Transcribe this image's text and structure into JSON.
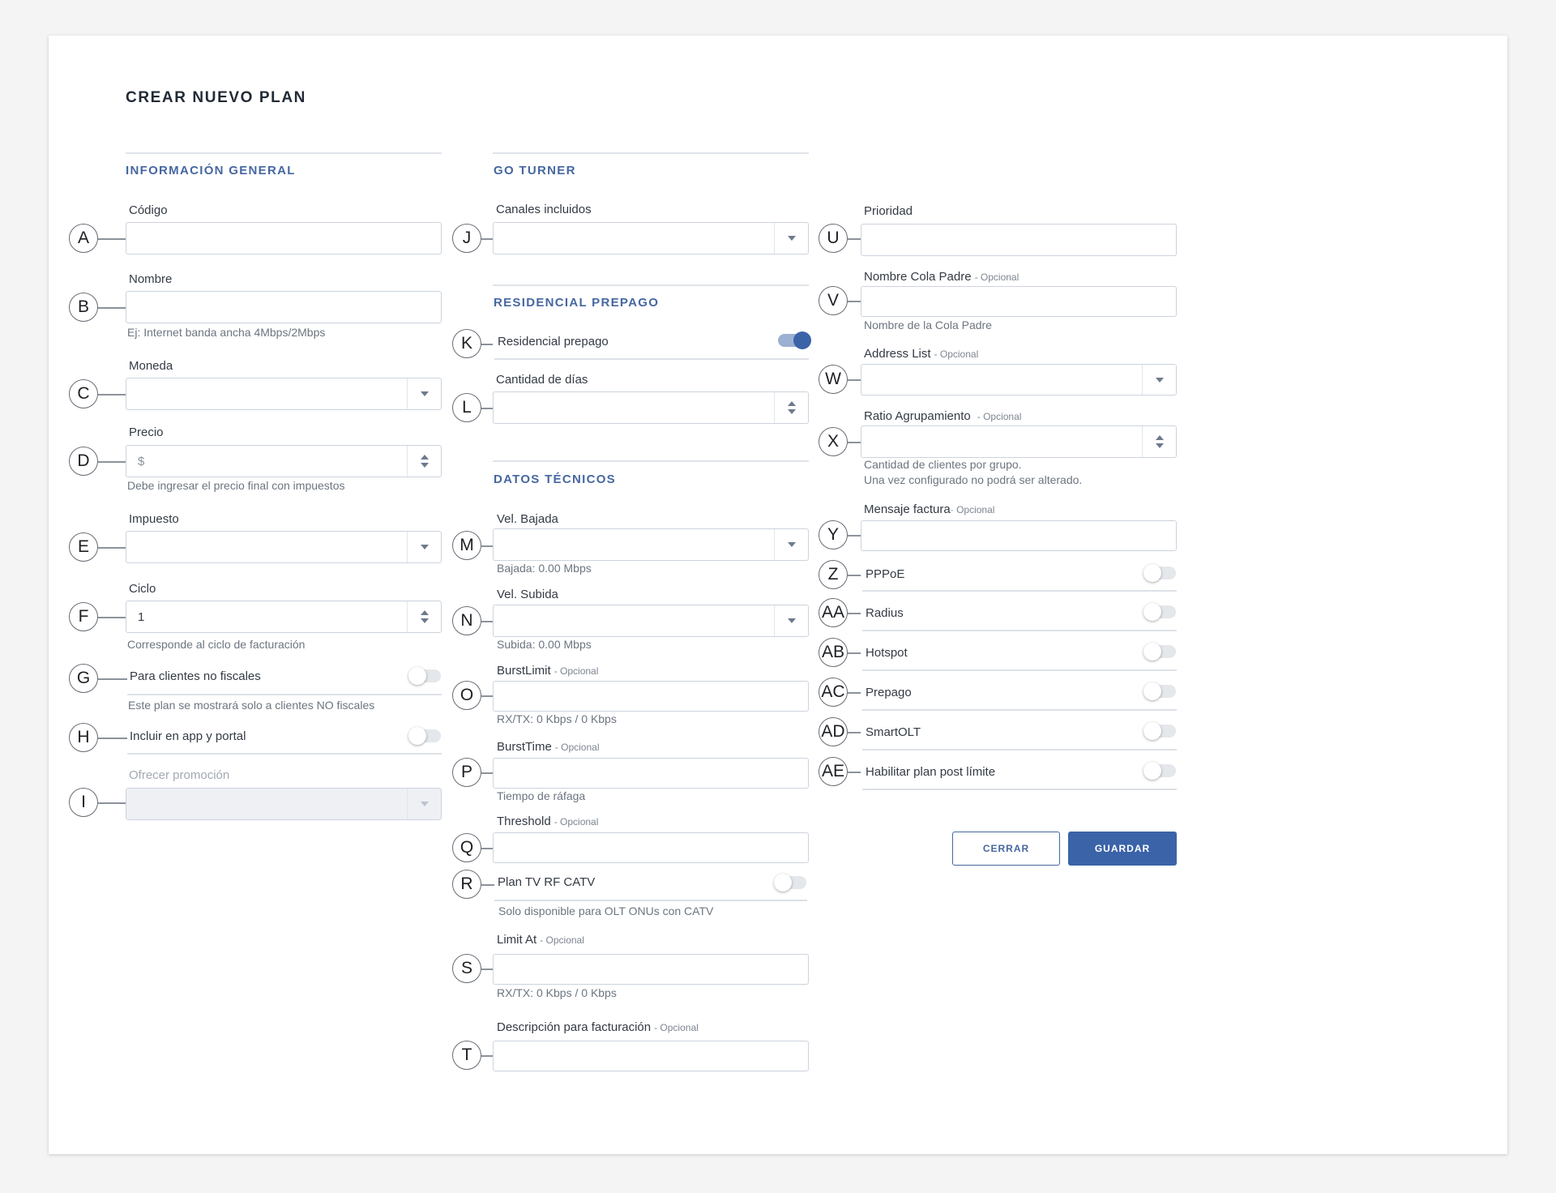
{
  "title": "CREAR NUEVO PLAN",
  "colors": {
    "accent": "#3b63a8",
    "section": "#4667a0"
  },
  "sections": {
    "general": "INFORMACIÓN GENERAL",
    "goturner": "GO TURNER",
    "prepago": "RESIDENCIAL PREPAGO",
    "tecnicos": "DATOS TÉCNICOS"
  },
  "optional_tag": "- Opcional",
  "optional_tag_compact": "· Opcional",
  "fields": {
    "codigo": {
      "marker": "A",
      "label": "Código",
      "value": ""
    },
    "nombre": {
      "marker": "B",
      "label": "Nombre",
      "value": "",
      "help": "Ej: Internet banda ancha 4Mbps/2Mbps"
    },
    "moneda": {
      "marker": "C",
      "label": "Moneda",
      "value": ""
    },
    "precio": {
      "marker": "D",
      "label": "Precio",
      "prefix": "$",
      "help": "Debe ingresar el precio final con impuestos"
    },
    "impuesto": {
      "marker": "E",
      "label": "Impuesto",
      "value": ""
    },
    "ciclo": {
      "marker": "F",
      "label": "Ciclo",
      "value": "1",
      "help": "Corresponde al ciclo de facturación"
    },
    "no_fiscales": {
      "marker": "G",
      "label": "Para clientes no fiscales",
      "on": false,
      "help": "Este plan se mostrará solo a clientes NO fiscales"
    },
    "app_portal": {
      "marker": "H",
      "label": "Incluir en app y portal",
      "on": false
    },
    "promocion": {
      "marker": "I",
      "label": "Ofrecer promoción",
      "value": "",
      "disabled": true
    },
    "canales": {
      "marker": "J",
      "label": "Canales incluidos",
      "value": ""
    },
    "residencial_prepago": {
      "marker": "K",
      "label": "Residencial prepago",
      "on": true
    },
    "cantidad_dias": {
      "marker": "L",
      "label": "Cantidad de días",
      "value": ""
    },
    "vel_bajada": {
      "marker": "M",
      "label": "Vel. Bajada",
      "value": "",
      "help": "Bajada: 0.00 Mbps"
    },
    "vel_subida": {
      "marker": "N",
      "label": "Vel. Subida",
      "value": "",
      "help": "Subida: 0.00 Mbps"
    },
    "burst_limit": {
      "marker": "O",
      "label": "BurstLimit",
      "value": "",
      "help": "RX/TX: 0 Kbps / 0 Kbps"
    },
    "burst_time": {
      "marker": "P",
      "label": "BurstTime",
      "value": "",
      "help": "Tiempo de ráfaga"
    },
    "threshold": {
      "marker": "Q",
      "label": "Threshold",
      "value": ""
    },
    "tv_rf_catv": {
      "marker": "R",
      "label": "Plan TV RF CATV",
      "on": false,
      "help": "Solo disponible para OLT ONUs con CATV"
    },
    "limit_at": {
      "marker": "S",
      "label": "Limit At",
      "value": "",
      "help": "RX/TX: 0 Kbps / 0 Kbps"
    },
    "descripcion": {
      "marker": "T",
      "label": "Descripción para facturación",
      "value": ""
    },
    "prioridad": {
      "marker": "U",
      "label": "Prioridad",
      "value": ""
    },
    "cola_padre": {
      "marker": "V",
      "label": "Nombre Cola Padre",
      "value": "",
      "help": "Nombre de la Cola Padre"
    },
    "address_list": {
      "marker": "W",
      "label": "Address List",
      "value": ""
    },
    "ratio": {
      "marker": "X",
      "label": "Ratio Agrupamiento",
      "value": "",
      "help1": "Cantidad de clientes por grupo.",
      "help2": "Una vez configurado no podrá ser alterado."
    },
    "mensaje": {
      "marker": "Y",
      "label": "Mensaje factura",
      "value": ""
    },
    "pppoe": {
      "marker": "Z",
      "label": "PPPoE",
      "on": false
    },
    "radius": {
      "marker": "AA",
      "label": "Radius",
      "on": false
    },
    "hotspot": {
      "marker": "AB",
      "label": "Hotspot",
      "on": false
    },
    "prepago": {
      "marker": "AC",
      "label": "Prepago",
      "on": false
    },
    "smartolt": {
      "marker": "AD",
      "label": "SmartOLT",
      "on": false
    },
    "post_limite": {
      "marker": "AE",
      "label": "Habilitar plan post límite",
      "on": false
    }
  },
  "buttons": {
    "close": "CERRAR",
    "save": "GUARDAR"
  }
}
